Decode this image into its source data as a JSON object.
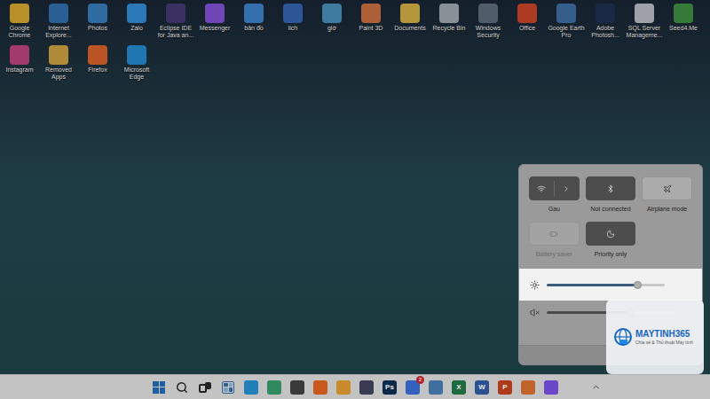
{
  "desktop": {
    "icons": [
      {
        "label": "Google Chrome",
        "color": "#b8902a"
      },
      {
        "label": "Internet Explore...",
        "color": "#2a5f94"
      },
      {
        "label": "Photos",
        "color": "#2f6aa0"
      },
      {
        "label": "Zalo",
        "color": "#2a78b8"
      },
      {
        "label": "Eclipse IDE for Java an...",
        "color": "#3a3160"
      },
      {
        "label": "Messenger",
        "color": "#6f46b8"
      },
      {
        "label": "bản đồ",
        "color": "#356fae"
      },
      {
        "label": "lich",
        "color": "#2c5696"
      },
      {
        "label": "giờ",
        "color": "#3f7aa0"
      },
      {
        "label": "Paint 3D",
        "color": "#ad6038"
      },
      {
        "label": "Documents",
        "color": "#b4963a"
      },
      {
        "label": "Recycle Bin",
        "color": "#8a9098"
      },
      {
        "label": "Windows Security",
        "color": "#4f5d6b"
      },
      {
        "label": "Office",
        "color": "#ad3a22"
      },
      {
        "label": "Google Earth Pro",
        "color": "#355f8a"
      },
      {
        "label": "Adobe Photosh...",
        "color": "#1b2a44"
      },
      {
        "label": "SQL Server Manageme...",
        "color": "#9ea2a8"
      },
      {
        "label": "Seed4.Me",
        "color": "#357a38"
      },
      {
        "label": "Instagram",
        "color": "#a33a6c"
      },
      {
        "label": "Removed Apps",
        "color": "#b08c3a"
      },
      {
        "label": "Firefox",
        "color": "#bb5424"
      },
      {
        "label": "Microsoft Edge",
        "color": "#1f76b0"
      }
    ]
  },
  "quick_settings": {
    "tiles": [
      {
        "label": "Gau",
        "kind": "split",
        "on": true,
        "disabled": false
      },
      {
        "label": "Not connected",
        "kind": "toggle",
        "on": true,
        "disabled": false
      },
      {
        "label": "Airplane mode",
        "kind": "toggle",
        "on": false,
        "disabled": false
      },
      {
        "label": "Battery saver",
        "kind": "toggle",
        "on": false,
        "disabled": true
      },
      {
        "label": "Priority only",
        "kind": "toggle",
        "on": true,
        "disabled": false
      }
    ],
    "brightness": {
      "level": 0.77,
      "highlighted": true
    },
    "volume": {
      "level": 0.64,
      "muted": true
    }
  },
  "taskbar": {
    "items": [
      {
        "kind": "start",
        "color": "#1f4f86"
      },
      {
        "kind": "search",
        "color": "#222222"
      },
      {
        "kind": "taskview",
        "color": "#222222"
      },
      {
        "kind": "widgets",
        "color": "#2f5f8f"
      },
      {
        "kind": "app",
        "color": "#1f7fb8"
      },
      {
        "kind": "app",
        "color": "#2f8a60"
      },
      {
        "kind": "app",
        "color": "#3a3a3a"
      },
      {
        "kind": "app",
        "color": "#c8581c"
      },
      {
        "kind": "app",
        "color": "#c88a2a"
      },
      {
        "kind": "app",
        "color": "#3a3a52"
      },
      {
        "kind": "app",
        "color": "#0b2a4a",
        "glyph": "Ps"
      },
      {
        "kind": "app",
        "color": "#3461c0",
        "badge": "2"
      },
      {
        "kind": "app",
        "color": "#3f6f9c"
      },
      {
        "kind": "app",
        "color": "#1d6a40",
        "glyph": "X"
      },
      {
        "kind": "app",
        "color": "#2b5290",
        "glyph": "W"
      },
      {
        "kind": "app",
        "color": "#b03a1c",
        "glyph": "P"
      },
      {
        "kind": "app",
        "color": "#c0642a"
      },
      {
        "kind": "app",
        "color": "#6a46c8"
      }
    ]
  },
  "watermark": {
    "title": "MAYTINH365",
    "subtitle": "Chia sẻ & Thủ thuật Máy tính"
  }
}
